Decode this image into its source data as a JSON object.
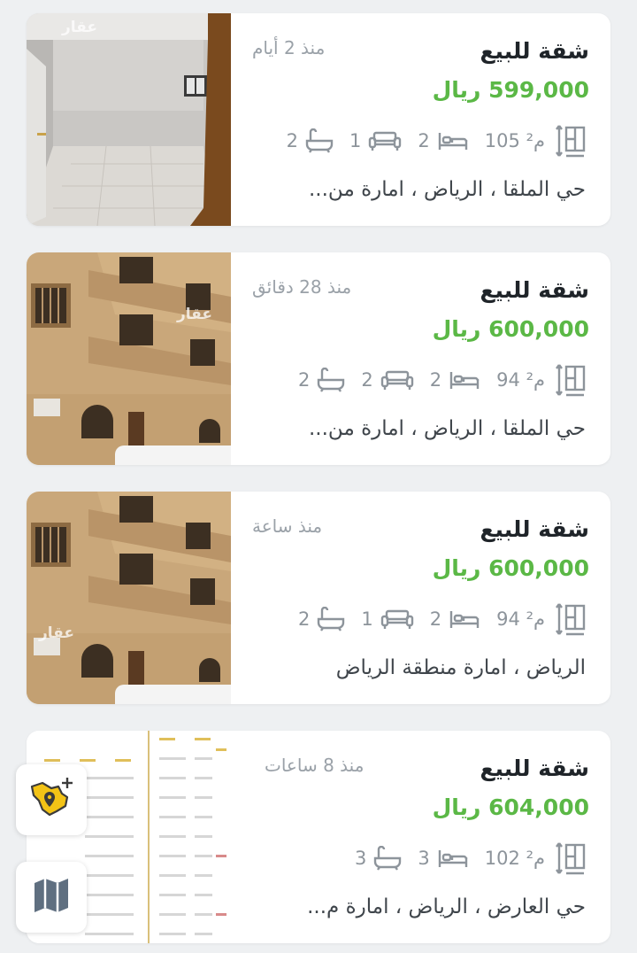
{
  "listings": [
    {
      "title": "شقة للبيع",
      "age": "منذ 2 أيام",
      "price": "599,000 ريال",
      "area": "105 م²",
      "bedrooms": "2",
      "living_rooms": "1",
      "bathrooms": "2",
      "location": "حي الملقا ، الرياض ، امارة من...",
      "watermark": "عقار"
    },
    {
      "title": "شقة للبيع",
      "age": "منذ 28 دقائق",
      "price": "600,000 ريال",
      "area": "94 م²",
      "bedrooms": "2",
      "living_rooms": "2",
      "bathrooms": "2",
      "location": "حي الملقا ، الرياض ، امارة من...",
      "watermark": "عقار"
    },
    {
      "title": "شقة للبيع",
      "age": "منذ ساعة",
      "price": "600,000 ريال",
      "area": "94 م²",
      "bedrooms": "2",
      "living_rooms": "1",
      "bathrooms": "2",
      "location": "الرياض ، امارة منطقة الرياض",
      "watermark": "عقار"
    },
    {
      "title": "شقة للبيع",
      "age": "منذ 8 ساعات",
      "price": "604,000 ريال",
      "area": "102 م²",
      "bedrooms": "3",
      "bathrooms": "3",
      "location": "حي العارض ، الرياض ، امارة م..."
    }
  ],
  "colors": {
    "price": "#5bb846",
    "title": "#1f2429",
    "muted": "#8d949b",
    "background": "#eef0f2",
    "map_fab_accent": "#f3c316"
  },
  "icons": {
    "area": "area-measure-icon",
    "bedroom": "bed-icon",
    "living_room": "sofa-icon",
    "bathroom": "bathtub-icon",
    "add_region": "saudi-map-add-pin-icon",
    "map": "folded-map-icon"
  }
}
